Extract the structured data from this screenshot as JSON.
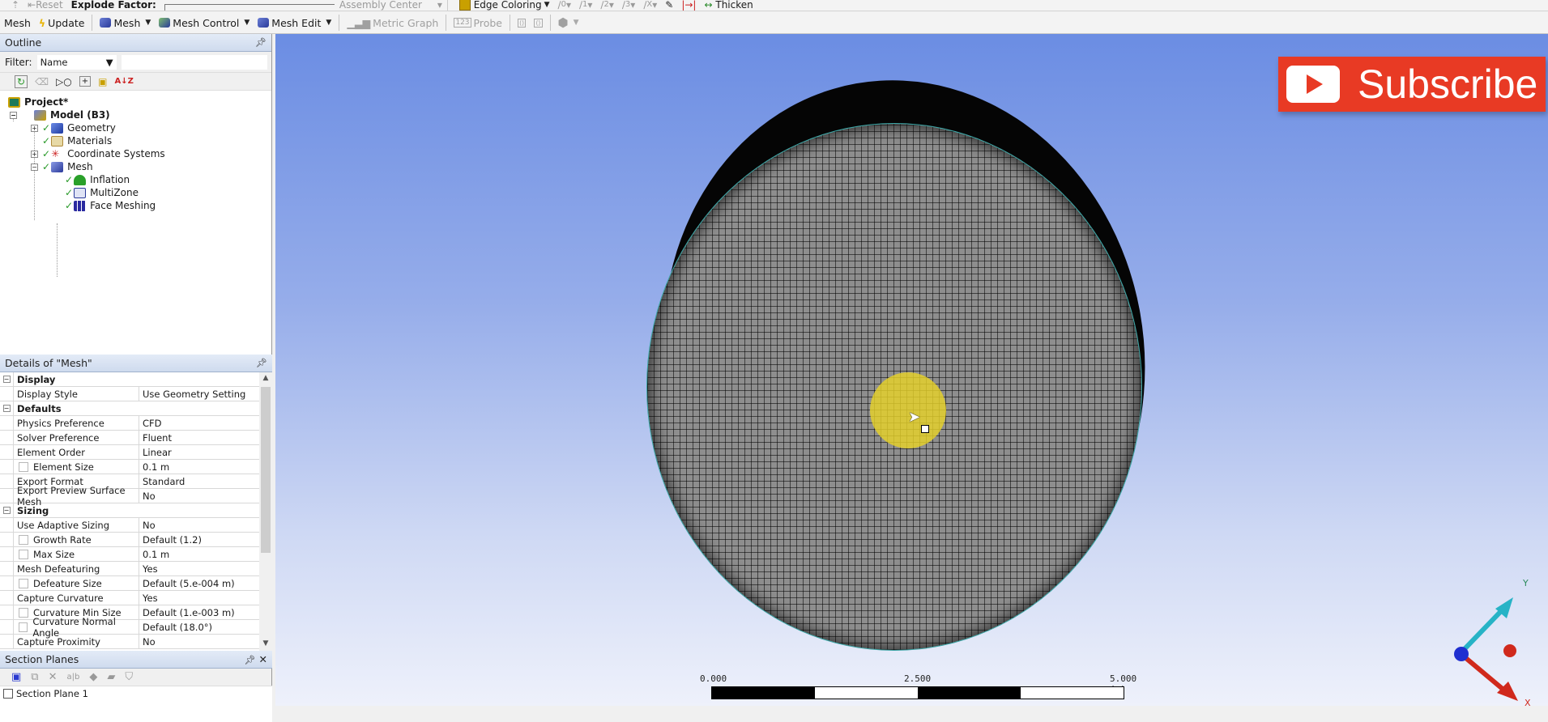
{
  "toolbar_top": {
    "items": [
      {
        "label": "Reset",
        "disabled": true
      },
      {
        "label": "Explode Factor:",
        "disabled": false
      },
      {
        "label": "Assembly Center",
        "disabled": true
      },
      {
        "label": "Edge Coloring",
        "disabled": false
      },
      {
        "label": "Thicken",
        "disabled": false
      }
    ],
    "edge_tools": [
      "0",
      "1",
      "2",
      "3",
      "X"
    ]
  },
  "toolbar_mesh": {
    "context_label": "Mesh",
    "update_label": "Update",
    "mesh_label": "Mesh",
    "mesh_control_label": "Mesh Control",
    "mesh_edit_label": "Mesh Edit",
    "metric_graph_label": "Metric Graph",
    "probe_label": "Probe"
  },
  "outline": {
    "title": "Outline",
    "filter_label": "Filter:",
    "filter_value": "Name",
    "filter_text": "",
    "tree": [
      {
        "label": "Project*",
        "level": 0,
        "bold": true,
        "icon": "project-icon"
      },
      {
        "label": "Model (B3)",
        "level": 1,
        "bold": true,
        "icon": "model-icon",
        "expanded": true
      },
      {
        "label": "Geometry",
        "level": 2,
        "icon": "geometry-icon",
        "status": "ok",
        "expander": "+"
      },
      {
        "label": "Materials",
        "level": 2,
        "icon": "materials-icon",
        "status": "ok"
      },
      {
        "label": "Coordinate Systems",
        "level": 2,
        "icon": "coordinate-systems-icon",
        "status": "ok",
        "expander": "+"
      },
      {
        "label": "Mesh",
        "level": 2,
        "icon": "mesh-icon",
        "status": "ok",
        "expander": "-"
      },
      {
        "label": "Inflation",
        "level": 3,
        "icon": "inflation-icon",
        "status": "ok"
      },
      {
        "label": "MultiZone",
        "level": 3,
        "icon": "multizone-icon",
        "status": "ok"
      },
      {
        "label": "Face Meshing",
        "level": 3,
        "icon": "face-meshing-icon",
        "status": "ok"
      }
    ]
  },
  "details": {
    "title": "Details of \"Mesh\"",
    "rows": [
      {
        "type": "category",
        "label": "Display"
      },
      {
        "label": "Display Style",
        "value": "Use Geometry Setting"
      },
      {
        "type": "category",
        "label": "Defaults"
      },
      {
        "label": "Physics Preference",
        "value": "CFD"
      },
      {
        "label": "Solver Preference",
        "value": "Fluent"
      },
      {
        "label": "Element Order",
        "value": "Linear"
      },
      {
        "label": "Element Size",
        "value": "0.1 m",
        "checkbox": true
      },
      {
        "label": "Export Format",
        "value": "Standard"
      },
      {
        "label": "Export Preview Surface Mesh",
        "value": "No"
      },
      {
        "type": "category",
        "label": "Sizing"
      },
      {
        "label": "Use Adaptive Sizing",
        "value": "No"
      },
      {
        "label": "Growth Rate",
        "value": "Default (1.2)",
        "checkbox": true
      },
      {
        "label": "Max Size",
        "value": "0.1 m",
        "checkbox": true
      },
      {
        "label": "Mesh Defeaturing",
        "value": "Yes"
      },
      {
        "label": "Defeature Size",
        "value": "Default (5.e-004 m)",
        "checkbox": true
      },
      {
        "label": "Capture Curvature",
        "value": "Yes"
      },
      {
        "label": "Curvature Min Size",
        "value": "Default (1.e-003 m)",
        "checkbox": true
      },
      {
        "label": "Curvature Normal Angle",
        "value": "Default (18.0°)",
        "checkbox": true
      },
      {
        "label": "Capture Proximity",
        "value": "No"
      }
    ]
  },
  "section_planes": {
    "title": "Section Planes",
    "items": [
      {
        "label": "Section Plane 1",
        "checked": false
      }
    ]
  },
  "viewport": {
    "subscribe_label": "Subscribe",
    "scale": {
      "labels": [
        "0.000",
        "2.500",
        "5.000 (m)"
      ]
    },
    "triad": {
      "y_label": "Y",
      "x_label": "X"
    },
    "colors": {
      "subscribe_bg": "#e83a24",
      "highlight": "#e6d228",
      "triad_y": "#27b3c6",
      "triad_x": "#d0291c",
      "triad_z": "#1f2fd0"
    }
  }
}
